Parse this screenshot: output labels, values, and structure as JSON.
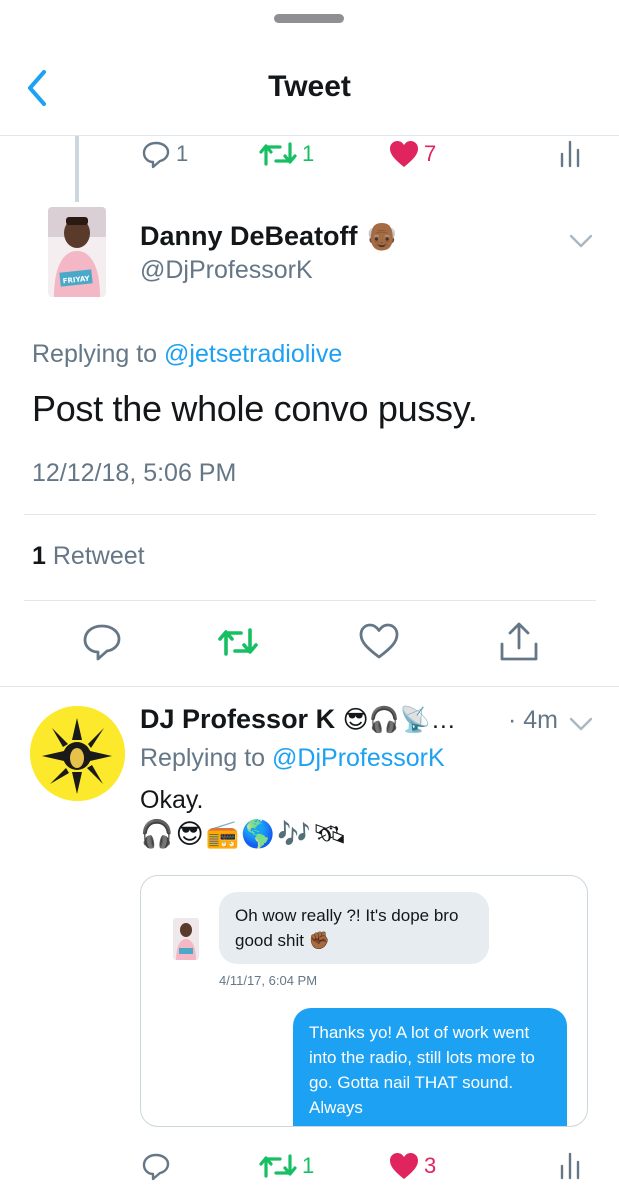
{
  "header": {
    "title": "Tweet"
  },
  "parent_actions": {
    "replies": "1",
    "retweets": "1",
    "likes": "7"
  },
  "tweet": {
    "author_name": "Danny DeBeatoff",
    "author_emoji": "👴🏾",
    "author_handle": "@DjProfessorK",
    "replying_prefix": "Replying to",
    "replying_to": "@jetsetradiolive",
    "text": "Post the whole convo pussy.",
    "timestamp": "12/12/18, 5:06 PM",
    "retweet_count": "1",
    "retweet_label": "Retweet",
    "avatar_shirt_text": "FRIYAY"
  },
  "reply": {
    "author_name": "DJ Professor K",
    "author_emojis": "😎🎧📡…",
    "age": "· 4m",
    "replying_prefix": "Replying to",
    "replying_to": "@DjProfessorK",
    "text": "Okay.",
    "emojis": "🎧😎📻🌎🎶🛰",
    "dm": {
      "incoming_text": "Oh wow really ?! It's dope bro good shit ✊🏾",
      "incoming_time": "4/11/17, 6:04 PM",
      "outgoing_text": "Thanks yo! A lot of work went into the radio, still lots more to go. Gotta nail THAT sound. Always"
    },
    "actions": {
      "retweets": "1",
      "likes": "3"
    }
  },
  "colors": {
    "accent": "#1da1f2",
    "retweet_green": "#17bf63",
    "like_red": "#e0245e",
    "muted_gray": "#657786",
    "divider": "#e1e8ed"
  }
}
